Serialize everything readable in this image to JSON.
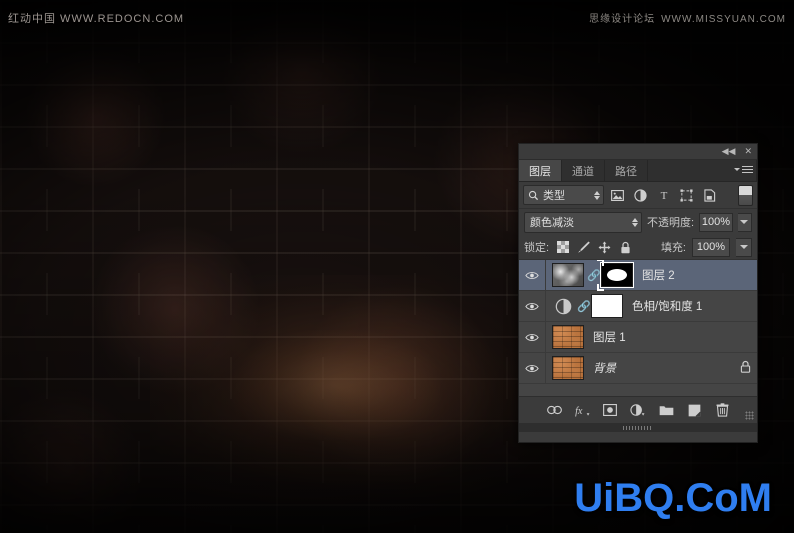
{
  "watermarks": {
    "top_left": "红动中国 WWW.REDOCN.COM",
    "top_right_cn": "思缘设计论坛",
    "top_right_en": "WWW.MISSYUAN.COM",
    "logo": "UiBQ.CoM",
    "logo_color": "#2f7ef0"
  },
  "canvas": {
    "description": "dark brick wall with warm spotlight glow",
    "brick_color": "#2a1a14",
    "mortar_color": "#6d6057",
    "glow_color": "#be7848"
  },
  "panel": {
    "topbar": {
      "collapse_icon": "collapse-double-arrow-icon",
      "close_icon": "close-icon"
    },
    "tabs": [
      {
        "label": "图层",
        "active": true
      },
      {
        "label": "通道",
        "active": false
      },
      {
        "label": "路径",
        "active": false
      }
    ],
    "menu_icon": "panel-menu-icon",
    "filter_bar": {
      "search_icon": "search-icon",
      "kind_label": "类型",
      "filter_icons": [
        "pixel-layer-filter-icon",
        "adjustment-layer-filter-icon",
        "type-layer-filter-icon",
        "shape-layer-filter-icon",
        "smart-object-filter-icon"
      ],
      "toggle_name": "filter-enable-toggle"
    },
    "blend_row": {
      "blend_mode": "颜色减淡",
      "opacity_label": "不透明度:",
      "opacity_value": "100%"
    },
    "lock_row": {
      "lock_label": "锁定:",
      "lock_icons": [
        "lock-transparent-pixels-icon",
        "lock-image-pixels-icon",
        "lock-position-icon",
        "lock-all-icon"
      ],
      "fill_label": "填充:",
      "fill_value": "100%"
    },
    "layers": [
      {
        "name": "图层 2",
        "selected": true,
        "visible": true,
        "italic": false,
        "thumb": "gray-cloud",
        "linked": true,
        "mask": "black-with-white-blob",
        "mask_selected": true,
        "locked": false
      },
      {
        "name": "色相/饱和度 1",
        "selected": false,
        "visible": true,
        "italic": false,
        "thumb": "adjustment-circle",
        "linked": true,
        "mask": "white",
        "mask_selected": false,
        "locked": false
      },
      {
        "name": "图层 1",
        "selected": false,
        "visible": true,
        "italic": false,
        "thumb": "brick",
        "linked": false,
        "mask": null,
        "mask_selected": false,
        "locked": false
      },
      {
        "name": "背景",
        "selected": false,
        "visible": true,
        "italic": true,
        "thumb": "brick",
        "linked": false,
        "mask": null,
        "mask_selected": false,
        "locked": true
      }
    ],
    "bottom_bar_icons": [
      "link-layers-icon",
      "layer-style-fx-icon",
      "add-layer-mask-icon",
      "new-adjustment-layer-icon",
      "new-group-icon",
      "new-layer-icon",
      "delete-layer-icon"
    ]
  }
}
